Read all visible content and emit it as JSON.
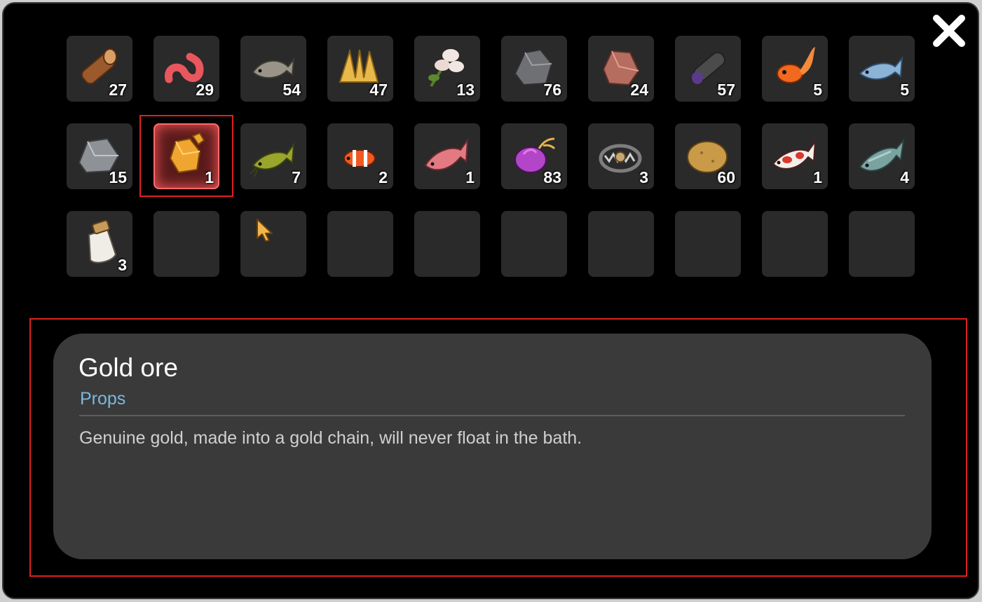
{
  "inventory": {
    "slots": [
      {
        "icon": "wood-log-icon",
        "count": "27"
      },
      {
        "icon": "worm-icon",
        "count": "29"
      },
      {
        "icon": "gray-fish-icon",
        "count": "54"
      },
      {
        "icon": "hay-bundle-icon",
        "count": "47"
      },
      {
        "icon": "cotton-plant-icon",
        "count": "13"
      },
      {
        "icon": "stone-icon",
        "count": "76"
      },
      {
        "icon": "copper-ore-icon",
        "count": "24"
      },
      {
        "icon": "rolled-cloth-icon",
        "count": "57"
      },
      {
        "icon": "goldfish-icon",
        "count": "5"
      },
      {
        "icon": "blue-fish-icon",
        "count": "5"
      },
      {
        "icon": "iron-ore-icon",
        "count": "15"
      },
      {
        "icon": "gold-ore-icon",
        "count": "1"
      },
      {
        "icon": "catfish-icon",
        "count": "7"
      },
      {
        "icon": "clownfish-icon",
        "count": "2"
      },
      {
        "icon": "red-fish-icon",
        "count": "1"
      },
      {
        "icon": "purple-fruit-icon",
        "count": "83"
      },
      {
        "icon": "bear-trap-icon",
        "count": "3"
      },
      {
        "icon": "potato-icon",
        "count": "60"
      },
      {
        "icon": "koi-fish-icon",
        "count": "1"
      },
      {
        "icon": "pike-fish-icon",
        "count": "4"
      },
      {
        "icon": "salt-jar-icon",
        "count": "3"
      },
      {
        "icon": "",
        "count": ""
      },
      {
        "icon": "",
        "count": ""
      },
      {
        "icon": "",
        "count": ""
      },
      {
        "icon": "",
        "count": ""
      },
      {
        "icon": "",
        "count": ""
      },
      {
        "icon": "",
        "count": ""
      },
      {
        "icon": "",
        "count": ""
      },
      {
        "icon": "",
        "count": ""
      },
      {
        "icon": "",
        "count": ""
      }
    ],
    "selected_index": 11
  },
  "detail": {
    "name": "Gold ore",
    "category": "Props",
    "description": "Genuine gold, made into a gold chain, will never float in the bath."
  },
  "icons": {
    "close": "close-icon",
    "cursor": "cursor-icon"
  },
  "colors": {
    "category": "#7bb9dd",
    "selection": "#e02020",
    "card": "#3a3a3a",
    "slot": "#2a2a2a"
  }
}
